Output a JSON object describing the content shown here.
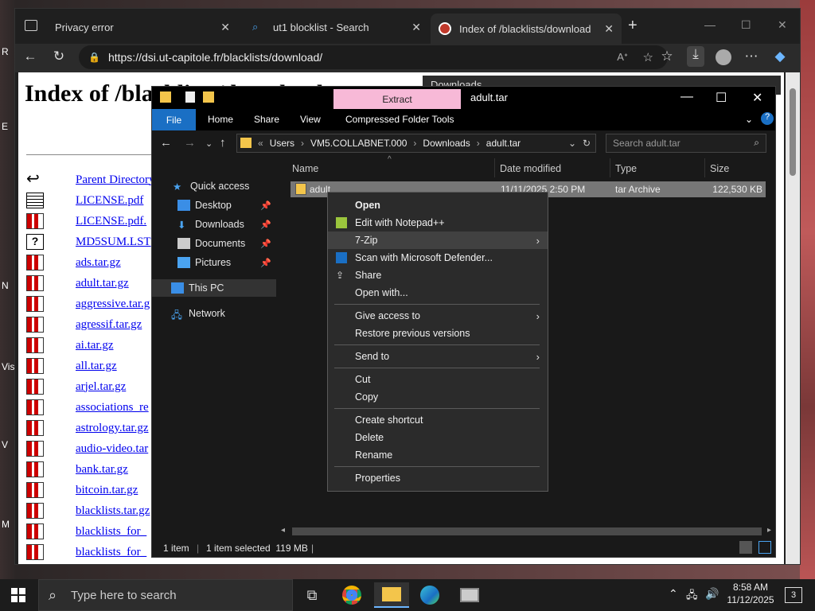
{
  "browser": {
    "tabs": [
      {
        "label": "Privacy error"
      },
      {
        "label": "ut1 blocklist - Search"
      },
      {
        "label": "Index of /blacklists/download"
      }
    ],
    "url": "https://dsi.ut-capitole.fr/blacklists/download/",
    "downloads_title": "Downloads"
  },
  "page": {
    "heading": "Index of /blacklists/download",
    "files": [
      {
        "name": "Parent Directory",
        "icon": "back-icon"
      },
      {
        "name": "LICENSE.pdf",
        "icon": "text-icon"
      },
      {
        "name": "LICENSE.pdf.",
        "icon": "compressed-icon"
      },
      {
        "name": "MD5SUM.LST",
        "icon": "unknown-icon"
      },
      {
        "name": "ads.tar.gz",
        "icon": "compressed-icon"
      },
      {
        "name": "adult.tar.gz",
        "icon": "compressed-icon"
      },
      {
        "name": "aggressive.tar.g",
        "icon": "compressed-icon"
      },
      {
        "name": "agressif.tar.gz",
        "icon": "compressed-icon"
      },
      {
        "name": "ai.tar.gz",
        "icon": "compressed-icon"
      },
      {
        "name": "all.tar.gz",
        "icon": "compressed-icon"
      },
      {
        "name": "arjel.tar.gz",
        "icon": "compressed-icon"
      },
      {
        "name": "associations_re",
        "icon": "compressed-icon"
      },
      {
        "name": "astrology.tar.gz",
        "icon": "compressed-icon"
      },
      {
        "name": "audio-video.tar",
        "icon": "compressed-icon"
      },
      {
        "name": "bank.tar.gz",
        "icon": "compressed-icon"
      },
      {
        "name": "bitcoin.tar.gz",
        "icon": "compressed-icon"
      },
      {
        "name": "blacklists.tar.gz",
        "icon": "compressed-icon"
      },
      {
        "name": "blacklists_for_",
        "icon": "compressed-icon"
      },
      {
        "name": "blacklists_for_",
        "icon": "compressed-icon"
      }
    ]
  },
  "explorer": {
    "title": "adult.tar",
    "extract_label": "Extract",
    "ribbon": {
      "file": "File",
      "home": "Home",
      "share": "Share",
      "view": "View",
      "tools": "Compressed Folder Tools"
    },
    "breadcrumb": [
      "Users",
      "VM5.COLLABNET.000",
      "Downloads",
      "adult.tar"
    ],
    "search_placeholder": "Search adult.tar",
    "sidebar": {
      "quick_access": "Quick access",
      "desktop": "Desktop",
      "downloads": "Downloads",
      "documents": "Documents",
      "pictures": "Pictures",
      "this_pc": "This PC",
      "network": "Network"
    },
    "columns": {
      "name": "Name",
      "date": "Date modified",
      "type": "Type",
      "size": "Size"
    },
    "file": {
      "name": "adult",
      "date": "11/11/2025 2:50 PM",
      "type": "tar Archive",
      "size": "122,530 KB"
    },
    "status": {
      "items": "1 item",
      "selected": "1 item selected  119 MB"
    }
  },
  "context_menu": {
    "open": "Open",
    "notepad": "Edit with Notepad++",
    "zip": "7-Zip",
    "defender": "Scan with Microsoft Defender...",
    "share": "Share",
    "open_with": "Open with...",
    "give_access": "Give access to",
    "restore": "Restore previous versions",
    "send_to": "Send to",
    "cut": "Cut",
    "copy": "Copy",
    "create_shortcut": "Create shortcut",
    "delete": "Delete",
    "rename": "Rename",
    "properties": "Properties"
  },
  "taskbar": {
    "search_placeholder": "Type here to search",
    "time": "8:58 AM",
    "date": "11/12/2025",
    "notifications": "3"
  },
  "desktop_labels": [
    "R",
    "E",
    "N",
    "Vis",
    "V",
    "M"
  ]
}
